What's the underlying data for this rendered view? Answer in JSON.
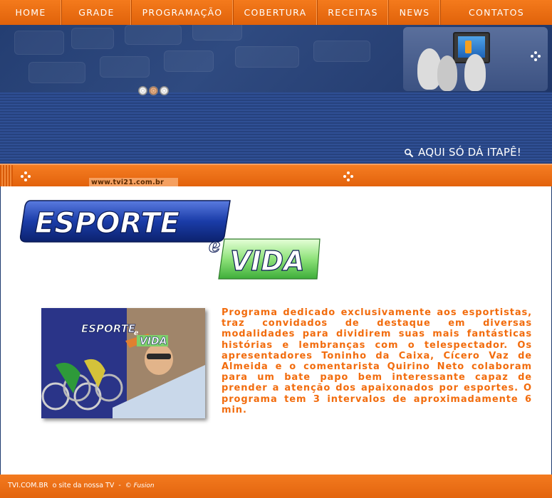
{
  "nav": {
    "items": [
      {
        "label": "HOME",
        "name": "nav-home"
      },
      {
        "label": "GRADE",
        "name": "nav-grade"
      },
      {
        "label": "PROGRAMAÇÃO",
        "name": "nav-programacao"
      },
      {
        "label": "COBERTURA",
        "name": "nav-cobertura"
      },
      {
        "label": "RECEITAS",
        "name": "nav-receitas"
      },
      {
        "label": "NEWS",
        "name": "nav-news"
      },
      {
        "label": "CONTATOS",
        "name": "nav-contatos"
      }
    ]
  },
  "banner": {
    "tagline": "AQUI SÓ DÁ ITAPÊ!",
    "tagline_icon": "magnifier-icon",
    "reel_icons": [
      "film-reel-icon",
      "film-reel-icon",
      "film-reel-icon"
    ]
  },
  "site_bar": {
    "url": "www.tvi21.com.br"
  },
  "program": {
    "logo_word_1": "ESPORTE",
    "logo_word_2": "e",
    "logo_word_3": "VIDA",
    "photo_logo_1": "ESPORTE",
    "photo_logo_2": "e",
    "photo_logo_3": "VIDA",
    "description": "Programa dedicado exclusivamente aos esportistas, traz convidados de destaque em diversas modalidades para dividirem suas mais fantásticas histórias e lembranças com o telespectador. Os apresentadores Toninho da Caixa, Cícero Vaz de Almeida e o comentarista Quirino Neto colaboram para um bate papo bem interessante capaz de prender a atenção dos apaixonados por esportes. O programa tem 3 intervalos de aproximadamente 6 min."
  },
  "footer": {
    "site": "TVI.COM.BR",
    "slogan": "o site da nossa TV",
    "separator": "-",
    "credit": "© Fusion"
  },
  "colors": {
    "orange": "#f26c0d",
    "navy": "#1e3a6e",
    "white": "#ffffff"
  }
}
